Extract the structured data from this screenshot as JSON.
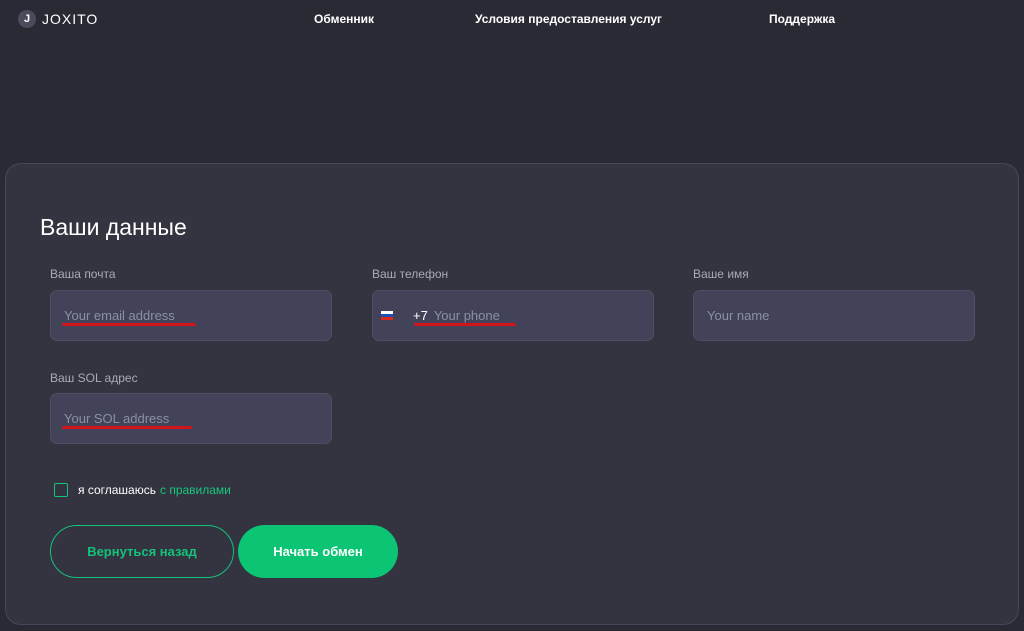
{
  "header": {
    "logo_letter": "J",
    "logo_text": "JOXITO",
    "nav": [
      {
        "label": "Обменник"
      },
      {
        "label": "Условия предоставления услуг"
      },
      {
        "label": "Поддержка"
      }
    ]
  },
  "form": {
    "title": "Ваши данные",
    "email": {
      "label": "Ваша почта",
      "placeholder": "Your email address",
      "value": ""
    },
    "phone": {
      "label": "Ваш телефон",
      "dial_code": "+7",
      "country_flag": "russia-flag-icon",
      "placeholder": "Your phone",
      "value": ""
    },
    "name": {
      "label": "Ваше имя",
      "placeholder": "Your name",
      "value": ""
    },
    "sol": {
      "label": "Ваш SOL адрес",
      "placeholder": "Your SOL address",
      "value": ""
    },
    "agree": {
      "checked": false,
      "text": "я соглашаюсь",
      "link_text": "с правилами"
    },
    "buttons": {
      "back": "Вернуться назад",
      "start": "Начать обмен"
    }
  },
  "colors": {
    "background": "#292a34",
    "card": "#33343f",
    "input": "#424358",
    "accent_green": "#0bc575",
    "annotation_red": "#d2141c"
  }
}
